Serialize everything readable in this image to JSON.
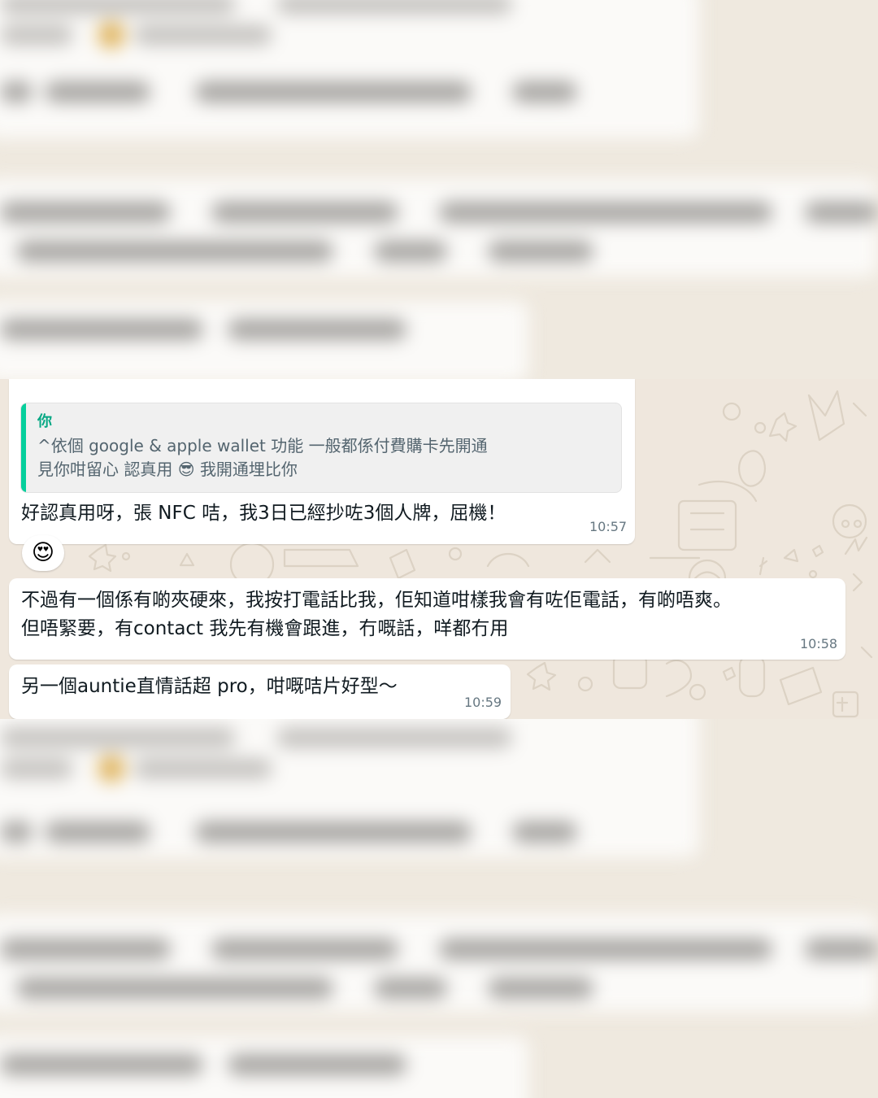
{
  "chat": {
    "messages": [
      {
        "quote": {
          "author": "你",
          "line1": "^依個 google & apple wallet 功能 一般都係付費購卡先開通",
          "line2_before": "見你咁留心 認真用",
          "line2_emoji": "😎",
          "line2_after": "我開通埋比你"
        },
        "text": "好認真用呀，張 NFC 咭，我3日已經抄咗3個人牌，屈機！",
        "time": "10:57",
        "reaction": "😍"
      },
      {
        "line1": "不過有一個係有啲夾硬來，我按打電話比我，佢知道咁樣我會有咗佢電話，有啲唔爽。",
        "line2": "但唔緊要，有contact 我先有機會跟進，冇嘅話，咩都冇用",
        "time": "10:58"
      },
      {
        "text": "另一個auntie直情話超 pro，咁嘅咭片好型～",
        "time": "10:59"
      }
    ]
  },
  "colors": {
    "wallpaper": "#efe7dd",
    "bubble": "#ffffff",
    "quote_accent": "#06cf9c",
    "quote_author": "#06a884",
    "timestamp": "#667781"
  }
}
